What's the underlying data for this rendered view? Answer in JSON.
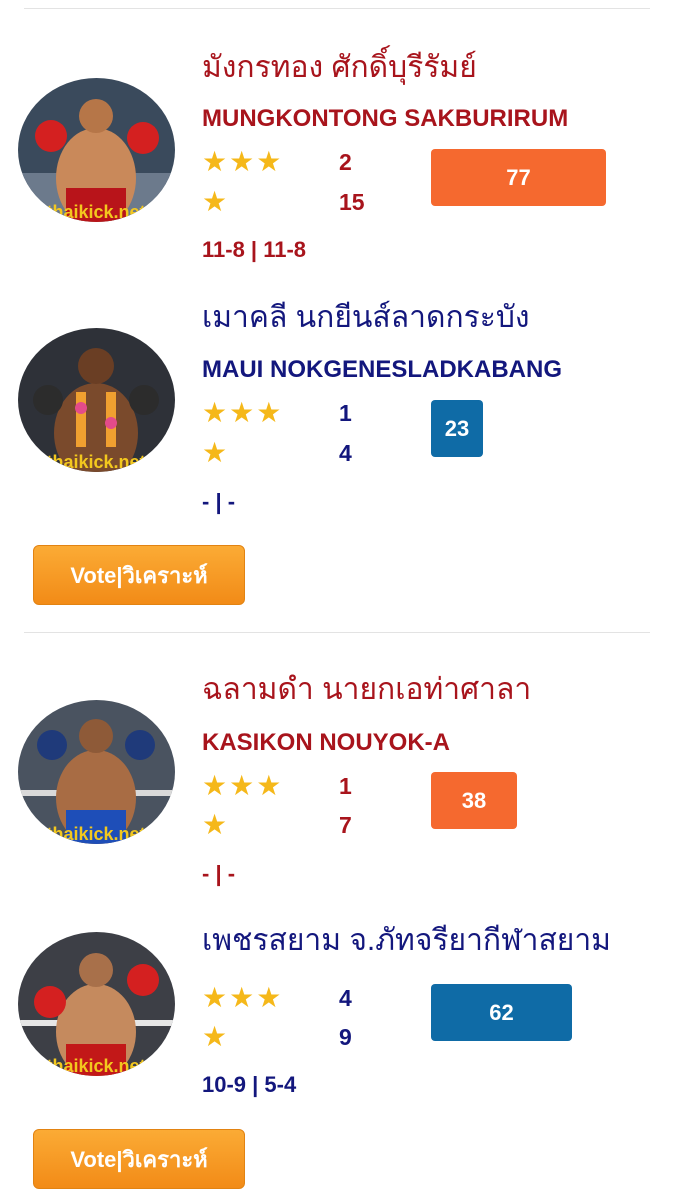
{
  "matches": [
    {
      "fighters": [
        {
          "thai_name": "มังกรทอง ศักดิ์บุรีรัมย์",
          "english_name": "MUNGKONTONG SAKBURIRUM",
          "three_star_count": "2",
          "one_star_count": "15",
          "record": "11-8 | 11-8",
          "score": "77",
          "color": "#a8141c",
          "watermark": "thaikick.net"
        },
        {
          "thai_name": "เมาคลี นกยีนส์ลาดกระบัง",
          "english_name": "MAUI NOKGENESLADKABANG",
          "three_star_count": "1",
          "one_star_count": "4",
          "record": "- | -",
          "score": "23",
          "color": "#13177d",
          "watermark": "thaikick.net"
        }
      ],
      "vote_label": "Vote|วิเคราะห์"
    },
    {
      "fighters": [
        {
          "thai_name": "ฉลามดำ นายกเอท่าศาลา",
          "english_name": "KASIKON NOUYOK-A",
          "three_star_count": "1",
          "one_star_count": "7",
          "record": "- | -",
          "score": "38",
          "color": "#a8141c",
          "watermark": "thaikick.net"
        },
        {
          "thai_name": "เพชรสยาม จ.ภัทจรียากีฬาสยาม",
          "english_name": "",
          "three_star_count": "4",
          "one_star_count": "9",
          "record": "10-9 | 5-4",
          "score": "62",
          "color": "#13177d",
          "watermark": "thaikick.net"
        }
      ],
      "vote_label": "Vote|วิเคราะห์"
    }
  ],
  "icons": {
    "star": "star-icon",
    "avatar": "fighter-photo"
  },
  "colors": {
    "red_corner": "#a8141c",
    "blue_corner": "#13177d",
    "orange_score": "#f5692f",
    "blue_score": "#0f6ba6",
    "star": "#f5b81a",
    "vote_button": "#f7931e"
  }
}
